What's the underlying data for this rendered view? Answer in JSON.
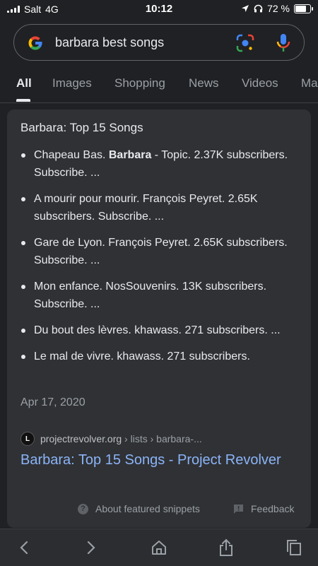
{
  "status": {
    "carrier": "Salt",
    "network": "4G",
    "time": "10:12",
    "battery": "72 %"
  },
  "search": {
    "query": "barbara best songs"
  },
  "tabs": [
    {
      "label": "All",
      "active": true
    },
    {
      "label": "Images"
    },
    {
      "label": "Shopping"
    },
    {
      "label": "News"
    },
    {
      "label": "Videos"
    },
    {
      "label": "Ma"
    }
  ],
  "snippet": {
    "title": "Barbara: Top 15 Songs",
    "items": [
      {
        "pre": "Chapeau Bas. ",
        "bold": "Barbara",
        "post": " - Topic. 2.37K subscribers. Subscribe. ..."
      },
      {
        "pre": "A mourir pour mourir. François Peyret. 2.65K subscribers. Subscribe. ...",
        "bold": "",
        "post": ""
      },
      {
        "pre": "Gare de Lyon. François Peyret. 2.65K subscribers. Subscribe. ...",
        "bold": "",
        "post": ""
      },
      {
        "pre": "Mon enfance. NosSouvenirs. 13K subscribers. Subscribe. ...",
        "bold": "",
        "post": ""
      },
      {
        "pre": "Du bout des lèvres. khawass. 271 subscribers. ...",
        "bold": "",
        "post": ""
      },
      {
        "pre": "Le mal de vivre. khawass. 271 subscribers.",
        "bold": "",
        "post": ""
      }
    ],
    "date": "Apr 17, 2020",
    "source_domain": "projectrevolver.org",
    "source_path": " › lists › barbara-...",
    "link_title": "Barbara: Top 15 Songs - Project Revolver",
    "about_label": "About featured snippets",
    "feedback_label": "Feedback"
  }
}
